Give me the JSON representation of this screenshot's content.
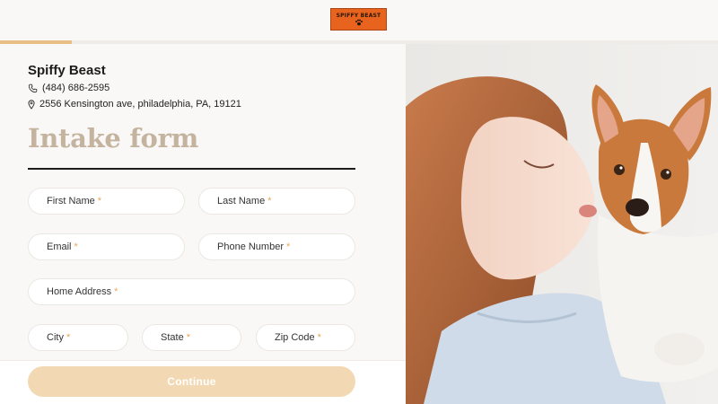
{
  "header": {
    "logo_text": "SPIFFY BEAST",
    "logo_icon": "paw-icon"
  },
  "progress": {
    "fraction": 0.1
  },
  "business": {
    "name": "Spiffy Beast",
    "phone": "(484) 686-2595",
    "address": "2556 Kensington ave, philadelphia, PA, 19121",
    "phone_icon": "phone-icon",
    "address_icon": "location-pin-icon"
  },
  "form": {
    "title": "Intake form",
    "required_mark": "*",
    "fields": {
      "first_name": "First Name",
      "last_name": "Last Name",
      "email": "Email",
      "phone": "Phone Number",
      "home_address": "Home Address",
      "city": "City",
      "state": "State",
      "zip": "Zip Code"
    },
    "continue_label": "Continue"
  },
  "colors": {
    "accent": "#e8bf86",
    "title": "#c4b39e",
    "required": "#e4a95a",
    "logo_bg": "#e8641e"
  }
}
